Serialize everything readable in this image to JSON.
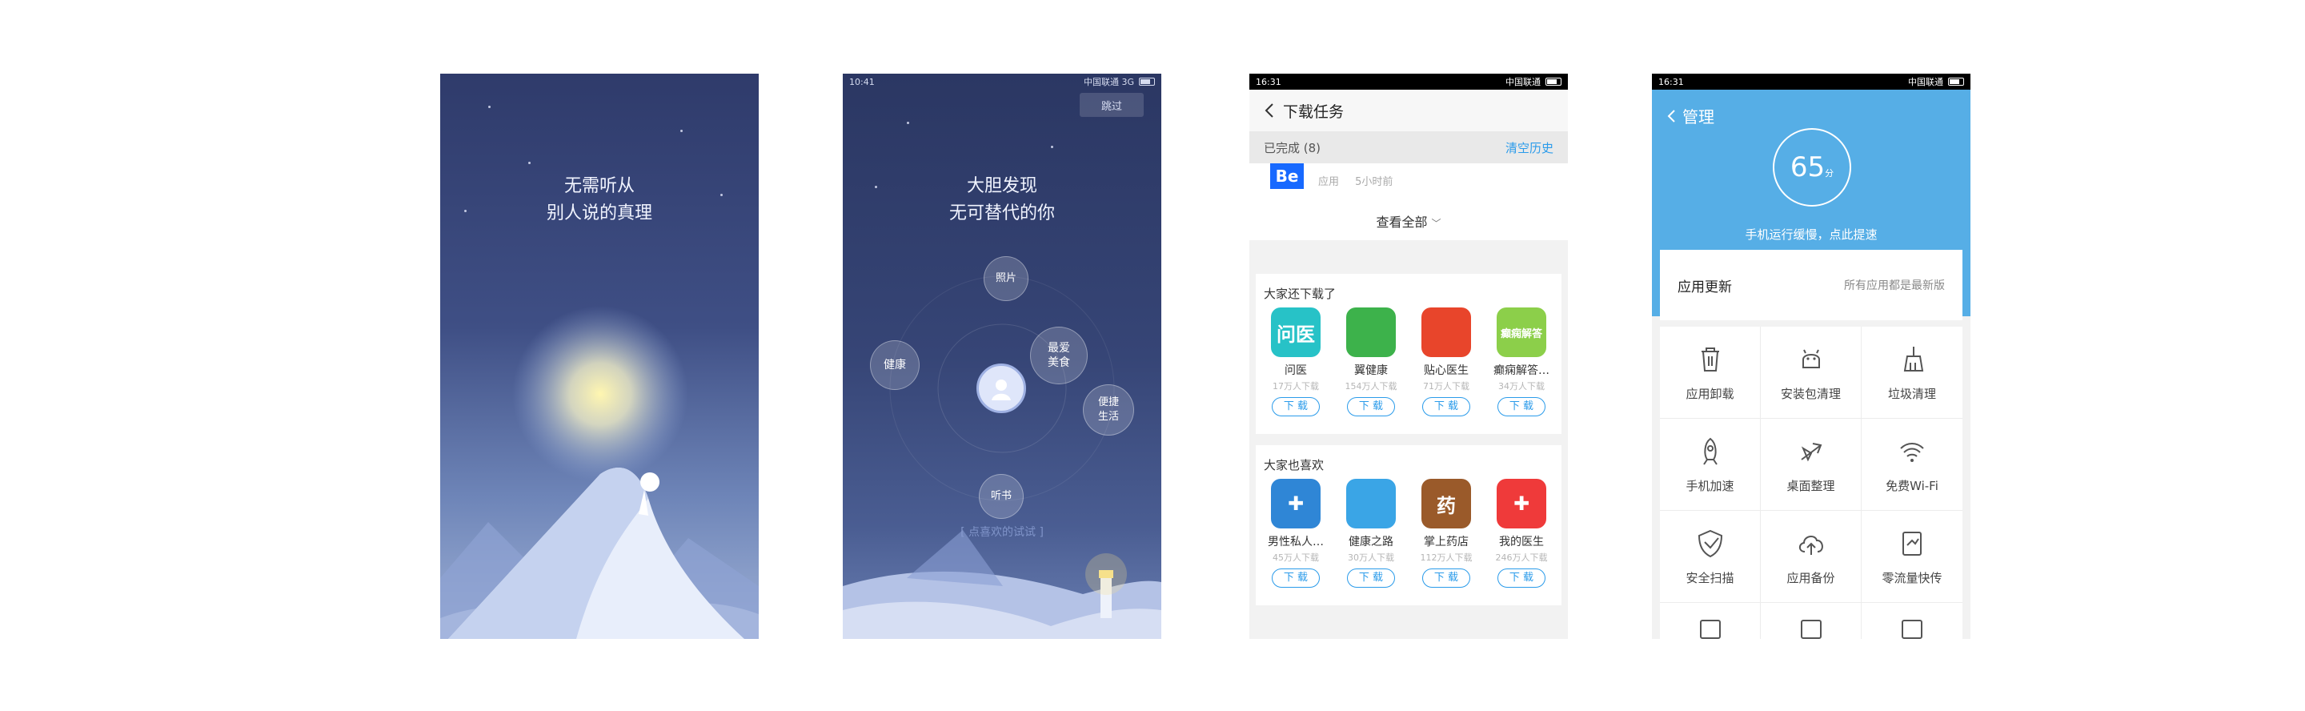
{
  "screen1": {
    "line1": "无需听从",
    "line2": "别人说的真理"
  },
  "screen2": {
    "status_time": "10:41",
    "status_carrier": "中国联通 3G",
    "skip_label": "跳过",
    "line1": "大胆发现",
    "line2": "无可替代的你",
    "bubbles": {
      "photos": "照片",
      "health": "健康",
      "food_line1": "最爱",
      "food_line2": "美食",
      "life_line1": "便捷",
      "life_line2": "生活",
      "audio": "听书"
    },
    "hint": "[ 点喜欢的试试 ]"
  },
  "screen3": {
    "status_time": "16:31",
    "status_carrier": "中国联通",
    "title": "下载任务",
    "completed_label": "已完成 (8)",
    "clear_history": "清空历史",
    "recent_app_icon_text": "Be",
    "recent_app_type": "应用",
    "recent_app_time": "5小时前",
    "see_all": "查看全部",
    "section1_title": "大家还下载了",
    "section1_apps": [
      {
        "name": "问医",
        "count": "17万人下载",
        "icon_text": "问医",
        "color": "#27c2c7"
      },
      {
        "name": "翼健康",
        "count": "154万人下载",
        "icon_text": "",
        "color": "#3db24b"
      },
      {
        "name": "贴心医生",
        "count": "71万人下载",
        "icon_text": "",
        "color": "#e8452b"
      },
      {
        "name": "癫痫解答…",
        "count": "34万人下载",
        "icon_text": "癫痫解答",
        "color": "#8ccf4a"
      }
    ],
    "section2_title": "大家也喜欢",
    "section2_apps": [
      {
        "name": "男性私人…",
        "count": "45万人下载",
        "icon_text": "✚",
        "color": "#2f86d6"
      },
      {
        "name": "健康之路",
        "count": "30万人下载",
        "icon_text": "",
        "color": "#3aa5e6"
      },
      {
        "name": "掌上药店",
        "count": "112万人下载",
        "icon_text": "药",
        "color": "#9a5a2a"
      },
      {
        "name": "我的医生",
        "count": "246万人下载",
        "icon_text": "✚",
        "color": "#ef3a3a"
      }
    ],
    "download_label": "下 载"
  },
  "screen4": {
    "status_time": "16:31",
    "status_carrier": "中国联通",
    "title": "管理",
    "score": "65",
    "score_unit": "分",
    "hint": "手机运行缓慢，点此提速",
    "update_title": "应用更新",
    "update_status": "所有应用都是最新版",
    "tools": [
      {
        "label": "应用卸载",
        "icon": "trash-icon"
      },
      {
        "label": "安装包清理",
        "icon": "android-icon"
      },
      {
        "label": "垃圾清理",
        "icon": "broom-icon"
      },
      {
        "label": "手机加速",
        "icon": "rocket-icon"
      },
      {
        "label": "桌面整理",
        "icon": "desktop-tidy-icon"
      },
      {
        "label": "免费Wi-Fi",
        "icon": "wifi-icon"
      },
      {
        "label": "安全扫描",
        "icon": "shield-icon"
      },
      {
        "label": "应用备份",
        "icon": "cloud-upload-icon"
      },
      {
        "label": "零流量快传",
        "icon": "transfer-icon"
      }
    ]
  },
  "colors": {
    "accent_blue": "#2a9bea",
    "header_blue": "#56aee6"
  }
}
